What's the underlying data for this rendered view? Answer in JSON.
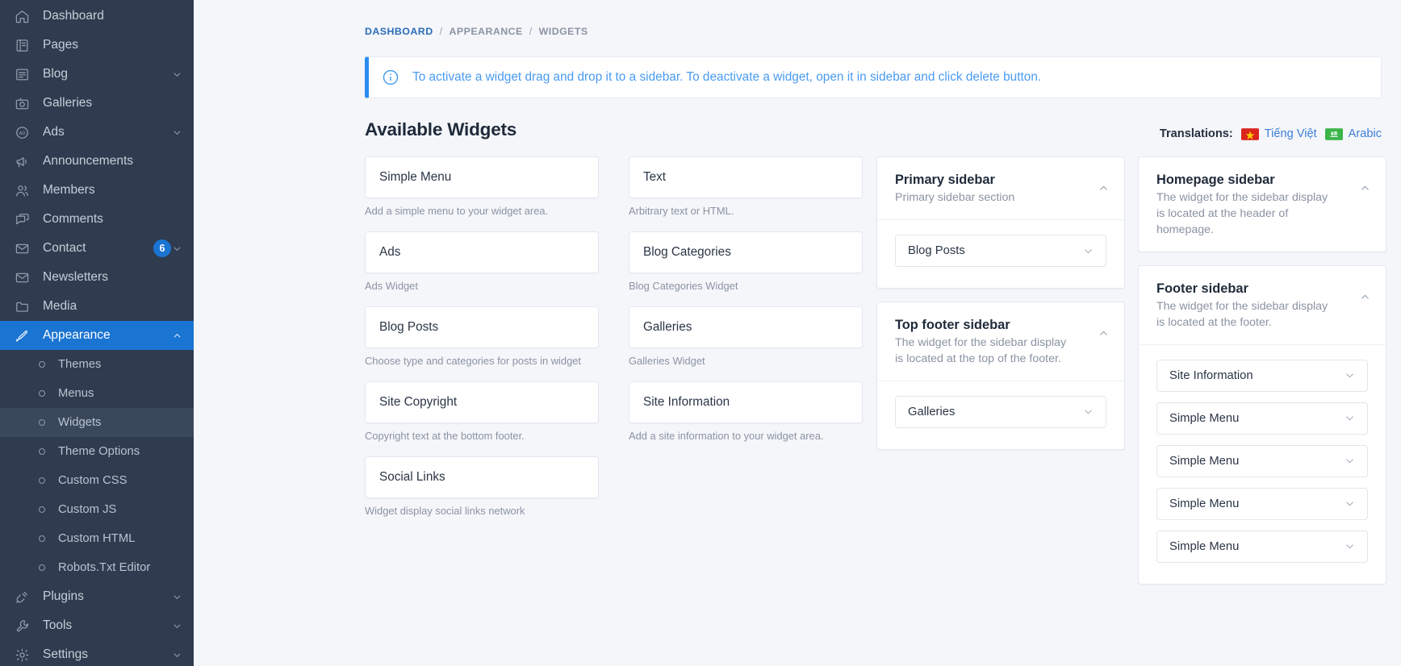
{
  "sidebar": {
    "items": [
      {
        "label": "Dashboard",
        "icon": "home-icon",
        "expandable": false
      },
      {
        "label": "Pages",
        "icon": "pages-icon",
        "expandable": false
      },
      {
        "label": "Blog",
        "icon": "blog-icon",
        "expandable": true
      },
      {
        "label": "Galleries",
        "icon": "camera-icon",
        "expandable": false
      },
      {
        "label": "Ads",
        "icon": "ad-icon",
        "expandable": true
      },
      {
        "label": "Announcements",
        "icon": "megaphone-icon",
        "expandable": false
      },
      {
        "label": "Members",
        "icon": "users-icon",
        "expandable": false
      },
      {
        "label": "Comments",
        "icon": "comments-icon",
        "expandable": false
      },
      {
        "label": "Contact",
        "icon": "mail-icon",
        "expandable": true,
        "badge": "6"
      },
      {
        "label": "Newsletters",
        "icon": "mail-icon",
        "expandable": false
      },
      {
        "label": "Media",
        "icon": "folder-icon",
        "expandable": false
      },
      {
        "label": "Appearance",
        "icon": "brush-icon",
        "expandable": true,
        "active": true,
        "expanded": true
      },
      {
        "label": "Plugins",
        "icon": "plug-icon",
        "expandable": true
      },
      {
        "label": "Tools",
        "icon": "wrench-icon",
        "expandable": true
      },
      {
        "label": "Settings",
        "icon": "gear-icon",
        "expandable": true
      }
    ],
    "appearance_children": [
      {
        "label": "Themes"
      },
      {
        "label": "Menus"
      },
      {
        "label": "Widgets",
        "current": true
      },
      {
        "label": "Theme Options"
      },
      {
        "label": "Custom CSS"
      },
      {
        "label": "Custom JS"
      },
      {
        "label": "Custom HTML"
      },
      {
        "label": "Robots.Txt Editor"
      }
    ],
    "colors": {
      "bg": "#2f3c4f",
      "active": "#1a74d2",
      "current_sub": "#3a485c"
    }
  },
  "breadcrumb": {
    "items": [
      "DASHBOARD",
      "APPEARANCE",
      "WIDGETS"
    ],
    "separator": "/"
  },
  "alert": {
    "icon": "info-circle-icon",
    "text": "To activate a widget drag and drop it to a sidebar. To deactivate a widget, open it in sidebar and click delete button.",
    "accent_color": "#2d8cf0"
  },
  "page_title": "Available Widgets",
  "translations": {
    "label": "Translations:",
    "links": [
      {
        "name": "Tiếng Việt",
        "flag": "vietnam-flag-icon",
        "flag_bg": "#da251d"
      },
      {
        "name": "Arabic",
        "flag": "arabic-flag-icon",
        "flag_bg": "#3ab54a"
      }
    ]
  },
  "available_widgets": [
    {
      "name": "Simple Menu",
      "description": "Add a simple menu to your widget area."
    },
    {
      "name": "Text",
      "description": "Arbitrary text or HTML."
    },
    {
      "name": "Ads",
      "description": "Ads Widget"
    },
    {
      "name": "Blog Categories",
      "description": "Blog Categories Widget"
    },
    {
      "name": "Blog Posts",
      "description": "Choose type and categories for posts in widget"
    },
    {
      "name": "Galleries",
      "description": "Galleries Widget"
    },
    {
      "name": "Site Copyright",
      "description": "Copyright text at the bottom footer."
    },
    {
      "name": "Site Information",
      "description": "Add a site information to your widget area."
    },
    {
      "name": "Social Links",
      "description": "Widget display social links network"
    }
  ],
  "sidebar_panels": {
    "column_left": [
      {
        "title": "Primary sidebar",
        "subtitle": "Primary sidebar section",
        "collapse_icon": "chevron-up-icon",
        "widgets": [
          "Blog Posts"
        ]
      },
      {
        "title": "Top footer sidebar",
        "subtitle": "The widget for the sidebar display is located at the top of the footer.",
        "collapse_icon": "chevron-up-icon",
        "widgets": [
          "Galleries"
        ]
      }
    ],
    "column_right": [
      {
        "title": "Homepage sidebar",
        "subtitle": "The widget for the sidebar display is located at the header of homepage.",
        "collapse_icon": "chevron-up-icon",
        "widgets": []
      },
      {
        "title": "Footer sidebar",
        "subtitle": "The widget for the sidebar display is located at the footer.",
        "collapse_icon": "chevron-up-icon",
        "widgets": [
          "Site Information",
          "Simple Menu",
          "Simple Menu",
          "Simple Menu",
          "Simple Menu"
        ]
      }
    ]
  }
}
